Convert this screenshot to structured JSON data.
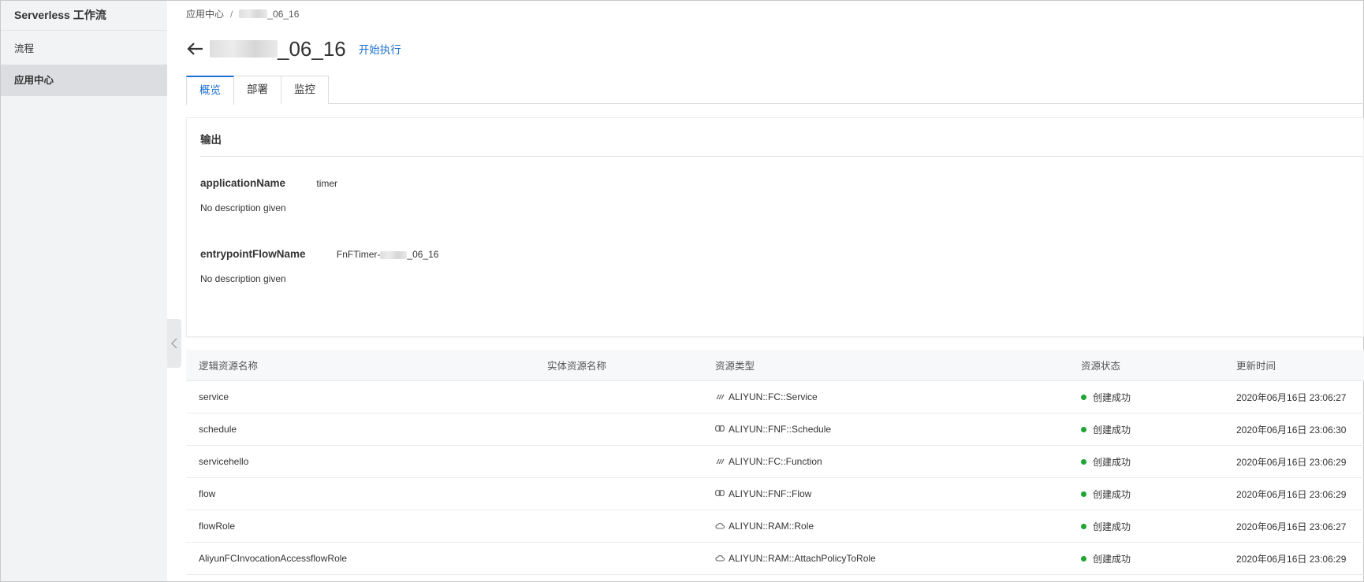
{
  "sidebar": {
    "title": "Serverless 工作流",
    "items": [
      {
        "label": "流程",
        "active": false
      },
      {
        "label": "应用中心",
        "active": true
      }
    ]
  },
  "breadcrumb": {
    "root": "应用中心",
    "separator": "/",
    "current_suffix": "_06_16"
  },
  "header": {
    "title_suffix": "_06_16",
    "start_label": "开始执行"
  },
  "tabs": [
    {
      "label": "概览",
      "active": true
    },
    {
      "label": "部署",
      "active": false
    },
    {
      "label": "监控",
      "active": false
    }
  ],
  "output": {
    "title": "输出",
    "entries": [
      {
        "key": "applicationName",
        "value": "timer",
        "description": "No description given"
      },
      {
        "key": "entrypointFlowName",
        "value_prefix": "FnFTimer-",
        "value_suffix": "_06_16",
        "description": "No description given"
      }
    ]
  },
  "table": {
    "headers": [
      "逻辑资源名称",
      "实体资源名称",
      "资源类型",
      "资源状态",
      "更新时间"
    ],
    "rows": [
      {
        "logical": "service",
        "physical": "",
        "type": "ALIYUN::FC::Service",
        "type_icon": "function-compute-icon",
        "status": "创建成功",
        "time": "2020年06月16日 23:06:27"
      },
      {
        "logical": "schedule",
        "physical": "",
        "type": "ALIYUN::FNF::Schedule",
        "type_icon": "link-icon",
        "status": "创建成功",
        "time": "2020年06月16日 23:06:30"
      },
      {
        "logical": "servicehello",
        "physical": "",
        "type": "ALIYUN::FC::Function",
        "type_icon": "function-compute-icon",
        "status": "创建成功",
        "time": "2020年06月16日 23:06:29"
      },
      {
        "logical": "flow",
        "physical": "",
        "type": "ALIYUN::FNF::Flow",
        "type_icon": "link-icon",
        "status": "创建成功",
        "time": "2020年06月16日 23:06:29"
      },
      {
        "logical": "flowRole",
        "physical": "",
        "type": "ALIYUN::RAM::Role",
        "type_icon": "cloud-icon",
        "status": "创建成功",
        "time": "2020年06月16日 23:06:27"
      },
      {
        "logical": "AliyunFCInvocationAccessflowRole",
        "physical": "",
        "type": "ALIYUN::RAM::AttachPolicyToRole",
        "type_icon": "cloud-icon",
        "status": "创建成功",
        "time": "2020年06月16日 23:06:29"
      }
    ],
    "status_color": "#1ea533"
  },
  "accent_color": "#1b6fd0"
}
